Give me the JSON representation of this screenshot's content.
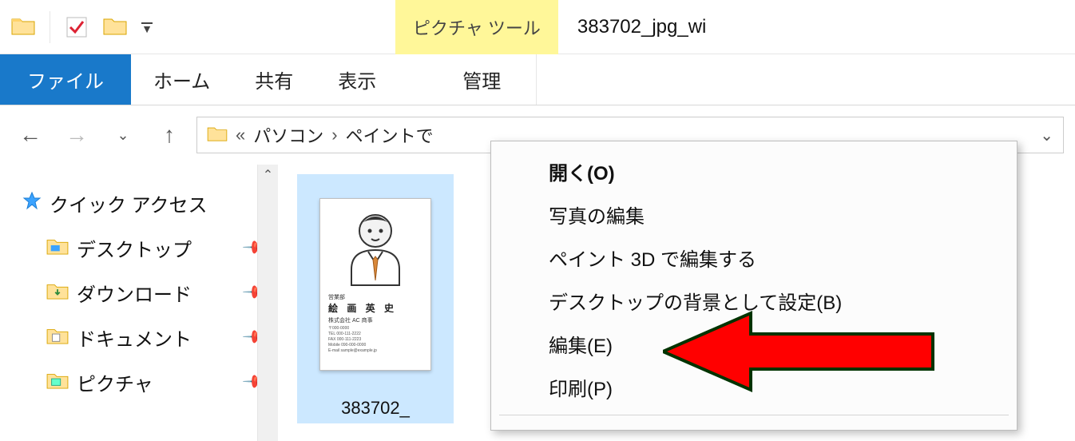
{
  "title_bar": {
    "contextual_tab_label": "ピクチャ ツール",
    "window_title": "383702_jpg_wi"
  },
  "ribbon": {
    "file": "ファイル",
    "home": "ホーム",
    "share": "共有",
    "view": "表示",
    "manage": "管理"
  },
  "address": {
    "prefix": "«",
    "seg1": "パソコン",
    "seg2": "ペイントで"
  },
  "sidebar": {
    "quick_access": "クイック アクセス",
    "desktop": "デスクトップ",
    "downloads": "ダウンロード",
    "documents": "ドキュメント",
    "pictures": "ピクチャ"
  },
  "thumbnail": {
    "caption": "383702_",
    "card_name": "絵 画 英 史",
    "card_company": "株式会社 AC 商事",
    "card_dept": "営業部"
  },
  "context_menu": {
    "open": "開く(O)",
    "edit_photo": "写真の編集",
    "paint3d": "ペイント 3D で編集する",
    "set_bg": "デスクトップの背景として設定(B)",
    "edit": "編集(E)",
    "print": "印刷(P)"
  }
}
